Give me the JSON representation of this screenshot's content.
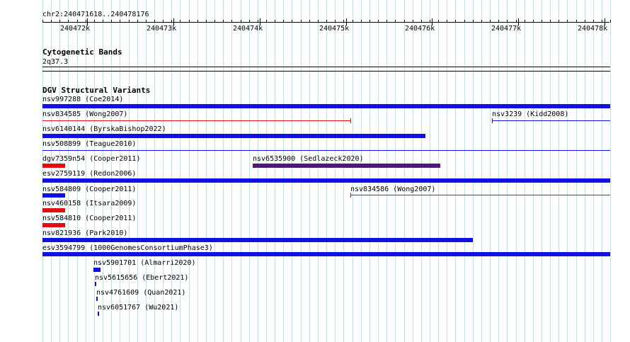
{
  "ruler": {
    "locus": "chr2:240471618..240478176",
    "labels": [
      "240472k",
      "240473k",
      "240474k",
      "240475k",
      "240476k",
      "240477k",
      "240478k"
    ]
  },
  "cytoband": {
    "title": "Cytogenetic Bands",
    "band": "2q37.3"
  },
  "dgv": {
    "title": "DGV Structural Variants",
    "items": [
      {
        "label": "nsv997288 (Coe2014)"
      },
      {
        "label": "nsv834585 (Wong2007)"
      },
      {
        "label": "nsv3239 (Kidd2008)"
      },
      {
        "label": "nsv6140144 (ByrskaBishop2022)"
      },
      {
        "label": "nsv508899 (Teague2010)"
      },
      {
        "label": "dgv7359n54 (Cooper2011)"
      },
      {
        "label": "nsv6535900 (Sedlazeck2020)"
      },
      {
        "label": "esv2759119 (Redon2006)"
      },
      {
        "label": "nsv584809 (Cooper2011)"
      },
      {
        "label": "nsv834586 (Wong2007)"
      },
      {
        "label": "nsv460158 (Itsara2009)"
      },
      {
        "label": "nsv584810 (Cooper2011)"
      },
      {
        "label": "nsv821936 (Park2010)"
      },
      {
        "label": "esv3594799 (1000GenomesConsortiumPhase3)"
      },
      {
        "label": "nsv5901701 (Almarri2020)"
      },
      {
        "label": "nsv5615656 (Ebert2021)"
      },
      {
        "label": "nsv4761609 (Quan2021)"
      },
      {
        "label": "nsv6051767 (Wu2021)"
      }
    ]
  },
  "colors": {
    "gain": "#1212e0",
    "loss": "#e01010",
    "complex": "#4a1a78",
    "grid": "#b9e2ea"
  }
}
